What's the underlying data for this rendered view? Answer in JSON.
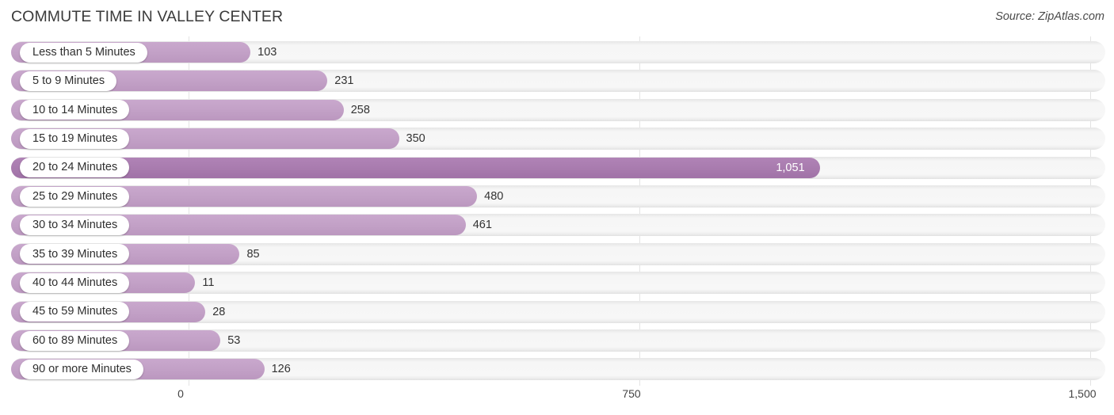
{
  "header": {
    "title": "COMMUTE TIME IN VALLEY CENTER",
    "source": "Source: ZipAtlas.com"
  },
  "colors": {
    "bar": "#c4a0c8",
    "bar_highlight": "#a87bae",
    "track": "#f5f5f5",
    "gridline": "#e3e3e3",
    "text": "#333333",
    "value_inside_text": "#ffffff"
  },
  "chart_data": {
    "type": "bar",
    "orientation": "horizontal",
    "title": "COMMUTE TIME IN VALLEY CENTER",
    "xlabel": "",
    "ylabel": "",
    "xlim": [
      0,
      1500
    ],
    "grid": true,
    "legend": null,
    "ticks": [
      "0",
      "750",
      "1,500"
    ],
    "tick_values": [
      0,
      750,
      1500
    ],
    "categories": [
      "Less than 5 Minutes",
      "5 to 9 Minutes",
      "10 to 14 Minutes",
      "15 to 19 Minutes",
      "20 to 24 Minutes",
      "25 to 29 Minutes",
      "30 to 34 Minutes",
      "35 to 39 Minutes",
      "40 to 44 Minutes",
      "45 to 59 Minutes",
      "60 to 89 Minutes",
      "90 or more Minutes"
    ],
    "values": [
      103,
      231,
      258,
      350,
      1051,
      480,
      461,
      85,
      11,
      28,
      53,
      126
    ],
    "value_labels": [
      "103",
      "231",
      "258",
      "350",
      "1,051",
      "480",
      "461",
      "85",
      "11",
      "28",
      "53",
      "126"
    ],
    "highlighted_index": 4
  }
}
